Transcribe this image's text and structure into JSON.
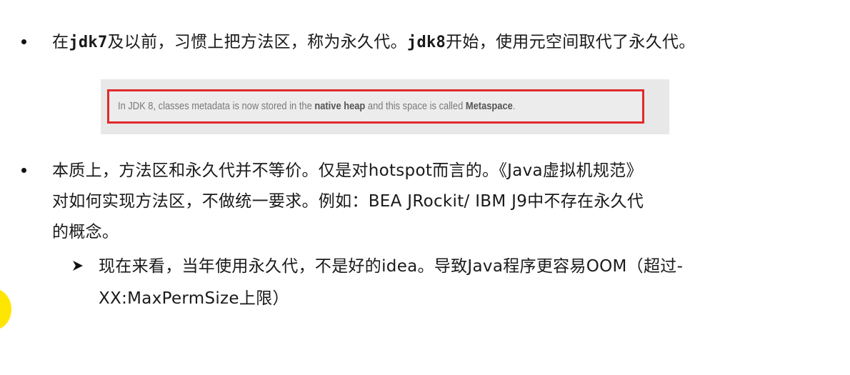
{
  "bullets": [
    {
      "line1": {
        "p1": "在",
        "c1": "jdk7",
        "p2": "及以前，习惯上把方法区，称为永久代。",
        "c2": "jdk8",
        "p3": "开始，使用元空间取代了永久代。"
      }
    },
    {
      "line1": "本质上，方法区和永久代并不等价。仅是对hotspot而言的。《Java虚拟机规范》",
      "line2": "对如何实现方法区，不做统一要求。例如：BEA JRockit/ IBM J9中不存在永久代",
      "line3": "的概念。"
    }
  ],
  "sub_bullet": {
    "line1": "现在来看，当年使用永久代，不是好的idea。导致Java程序更容易OOM（超过-",
    "line2": "XX:MaxPermSize上限）"
  },
  "quote": {
    "prefix": "In JDK 8, classes metadata is now stored in the ",
    "bold1": "native heap",
    "middle": " and this space is called ",
    "bold2": "Metaspace",
    "suffix": "."
  },
  "colors": {
    "highlight_border": "#e02a2a",
    "cursor_marker": "#ffe600"
  },
  "icons": {
    "bullet": "filled-circle",
    "sub_bullet": "arrowhead-right",
    "cursor": "yellow-pointer-dot"
  }
}
